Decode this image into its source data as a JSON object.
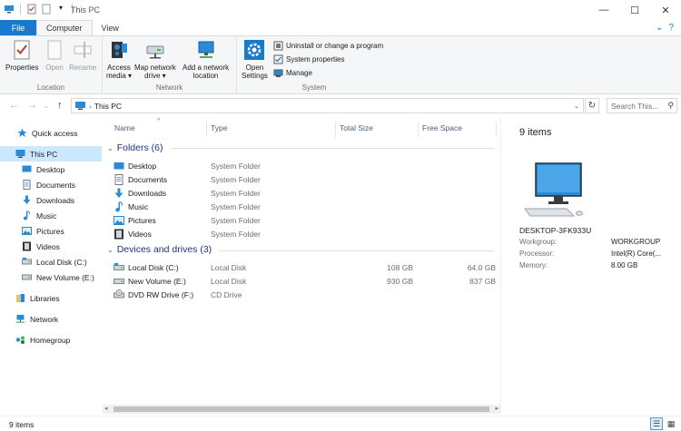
{
  "window": {
    "title": "This PC"
  },
  "tabs": {
    "file": "File",
    "computer": "Computer",
    "view": "View"
  },
  "ribbon": {
    "location": {
      "label": "Location",
      "properties": "Properties",
      "open": "Open",
      "rename": "Rename"
    },
    "network": {
      "label": "Network",
      "access_media_1": "Access",
      "access_media_2": "media ▾",
      "map_drive_1": "Map network",
      "map_drive_2": "drive ▾",
      "add_location_1": "Add a network",
      "add_location_2": "location"
    },
    "system": {
      "label": "System",
      "open_settings_1": "Open",
      "open_settings_2": "Settings",
      "uninstall": "Uninstall or change a program",
      "system_properties": "System properties",
      "manage": "Manage"
    }
  },
  "address": {
    "crumb": "This PC",
    "search_placeholder": "Search This..."
  },
  "nav": {
    "items": [
      {
        "label": "Quick access",
        "icon": "star-icon"
      },
      {
        "label": "This PC",
        "icon": "computer-icon"
      },
      {
        "label": "Desktop",
        "icon": "desktop-icon"
      },
      {
        "label": "Documents",
        "icon": "documents-icon"
      },
      {
        "label": "Downloads",
        "icon": "downloads-icon"
      },
      {
        "label": "Music",
        "icon": "music-icon"
      },
      {
        "label": "Pictures",
        "icon": "pictures-icon"
      },
      {
        "label": "Videos",
        "icon": "videos-icon"
      },
      {
        "label": "Local Disk (C:)",
        "icon": "drive-icon"
      },
      {
        "label": "New Volume (E:)",
        "icon": "drive-icon"
      },
      {
        "label": "Libraries",
        "icon": "libraries-icon"
      },
      {
        "label": "Network",
        "icon": "network-icon"
      },
      {
        "label": "Homegroup",
        "icon": "homegroup-icon"
      }
    ]
  },
  "columns": {
    "name": "Name",
    "type": "Type",
    "total_size": "Total Size",
    "free_space": "Free Space"
  },
  "groups": {
    "folders": {
      "heading": "Folders (6)",
      "rows": [
        {
          "name": "Desktop",
          "type": "System Folder",
          "icon": "desktop-icon"
        },
        {
          "name": "Documents",
          "type": "System Folder",
          "icon": "documents-icon"
        },
        {
          "name": "Downloads",
          "type": "System Folder",
          "icon": "downloads-icon"
        },
        {
          "name": "Music",
          "type": "System Folder",
          "icon": "music-icon"
        },
        {
          "name": "Pictures",
          "type": "System Folder",
          "icon": "pictures-icon"
        },
        {
          "name": "Videos",
          "type": "System Folder",
          "icon": "videos-icon"
        }
      ]
    },
    "drives": {
      "heading": "Devices and drives (3)",
      "rows": [
        {
          "name": "Local Disk (C:)",
          "type": "Local Disk",
          "total": "108 GB",
          "free": "64.0 GB",
          "icon": "drive-icon"
        },
        {
          "name": "New Volume (E:)",
          "type": "Local Disk",
          "total": "930 GB",
          "free": "837 GB",
          "icon": "drive-icon"
        },
        {
          "name": "DVD RW Drive (F:)",
          "type": "CD Drive",
          "total": "",
          "free": "",
          "icon": "dvd-drive-icon"
        }
      ]
    }
  },
  "details": {
    "count": "9 items",
    "computer_name": "DESKTOP-3FK933U",
    "workgroup_label": "Workgroup:",
    "workgroup_value": "WORKGROUP",
    "processor_label": "Processor:",
    "processor_value": "Intel(R) Core(...",
    "memory_label": "Memory:",
    "memory_value": "8.00 GB"
  },
  "status": {
    "count": "9 items"
  },
  "colors": {
    "accent": "#1979ca",
    "selection": "#cce8ff",
    "group_heading": "#1e3287"
  }
}
